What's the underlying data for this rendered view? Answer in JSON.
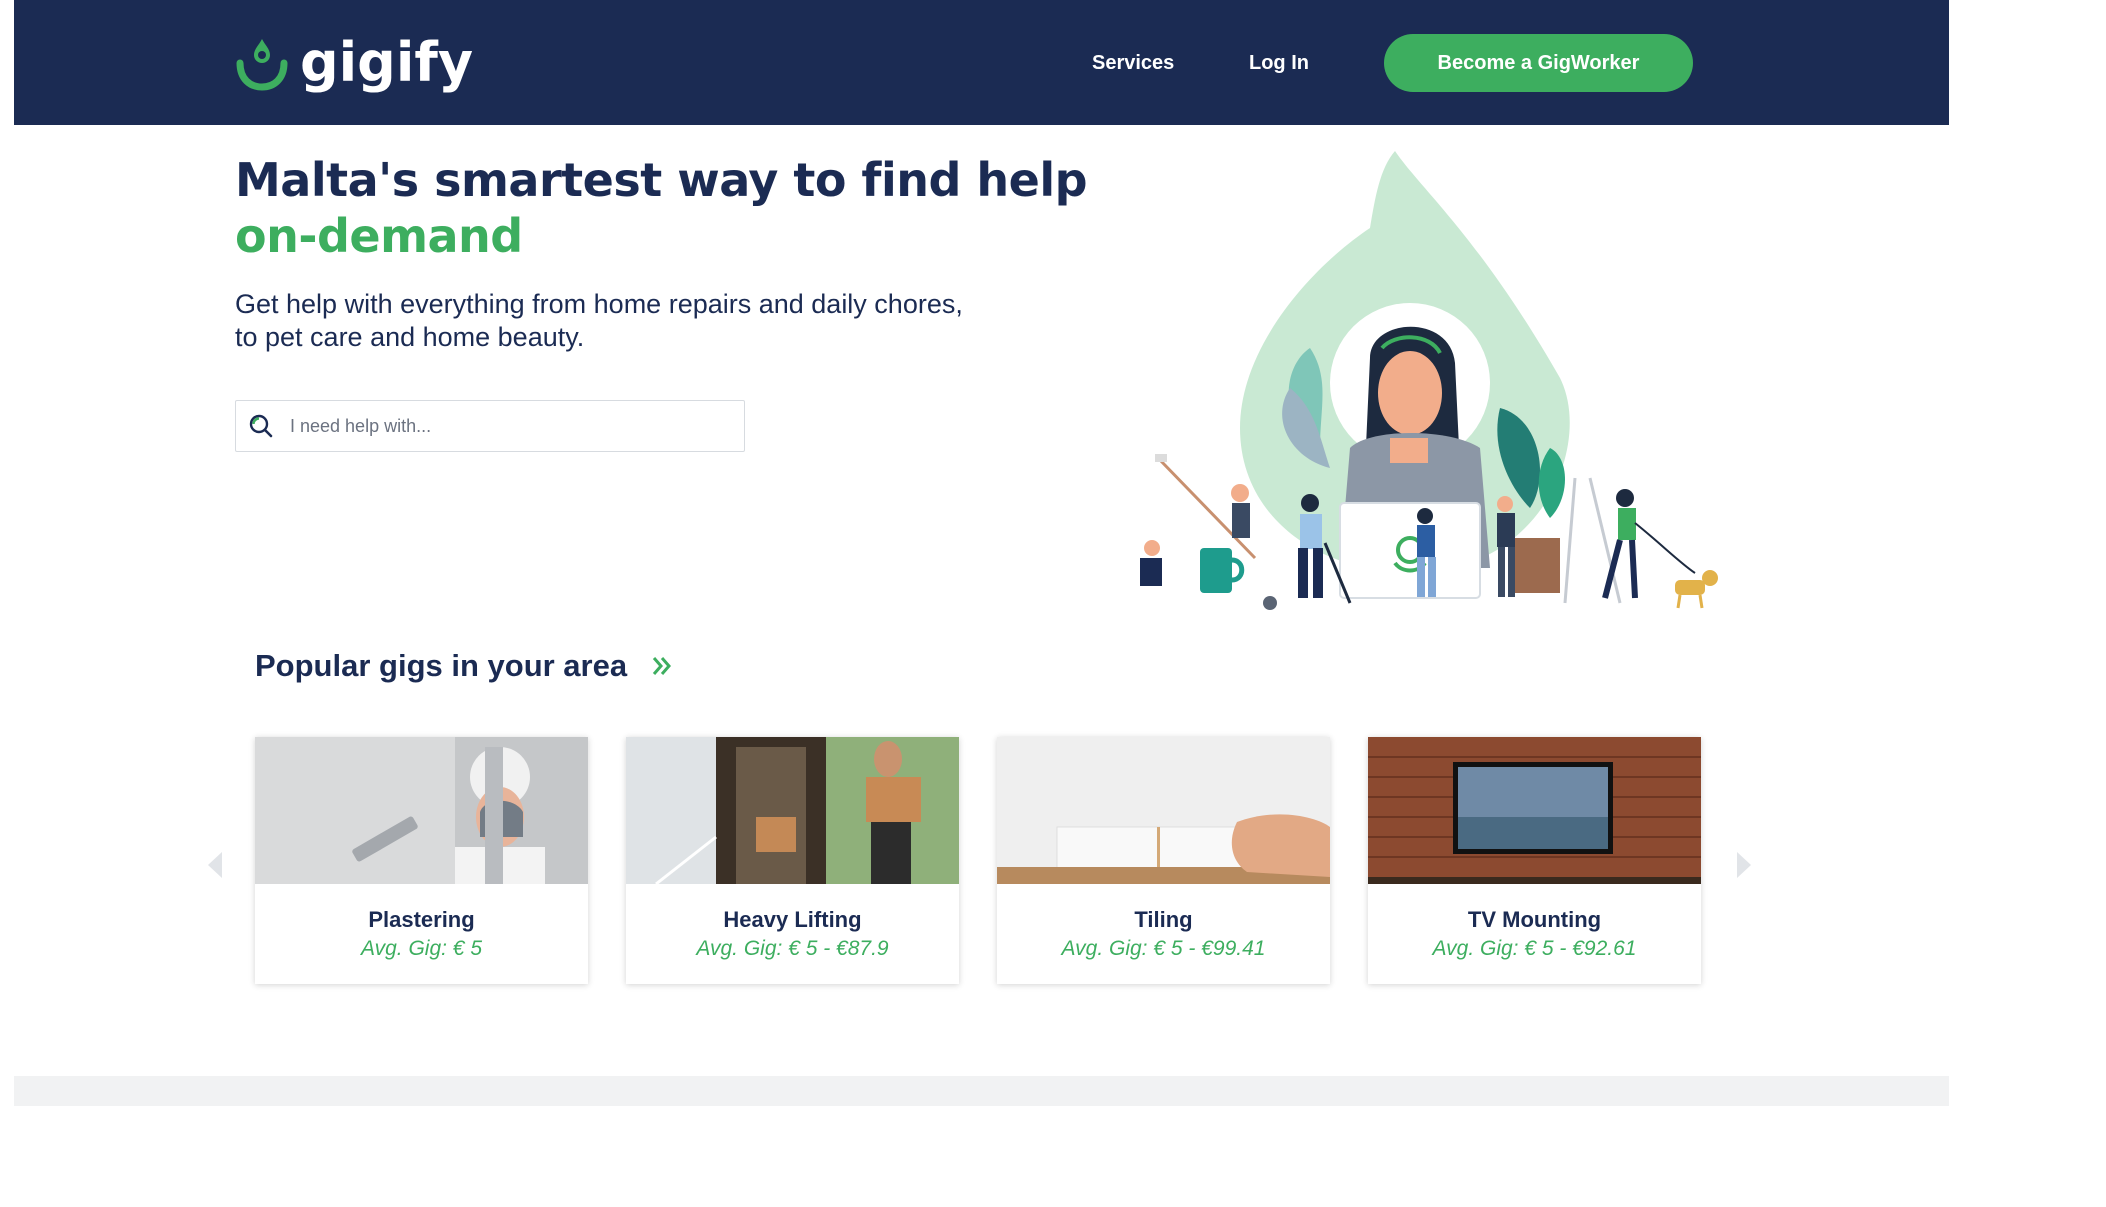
{
  "brand": {
    "name": "gigify",
    "primary_color": "#1b2b53",
    "accent_color": "#3dae5f"
  },
  "nav": {
    "services": "Services",
    "login": "Log In",
    "cta": "Become a GigWorker"
  },
  "hero": {
    "title_line1": "Malta's smartest way to find help",
    "title_line2": "on-demand",
    "subtitle_line1": "Get help with everything from home repairs and daily chores,",
    "subtitle_line2": "to pet care and home beauty."
  },
  "search": {
    "placeholder": "I need help with...",
    "icon": "search-icon"
  },
  "popular": {
    "title": "Popular gigs in your area",
    "cards": [
      {
        "name": "Plastering",
        "price": "Avg. Gig: € 5"
      },
      {
        "name": "Heavy Lifting",
        "price": "Avg. Gig: € 5 - €87.9"
      },
      {
        "name": "Tiling",
        "price": "Avg. Gig: € 5 - €99.41"
      },
      {
        "name": "TV Mounting",
        "price": "Avg. Gig: € 5 - €92.61"
      }
    ]
  }
}
